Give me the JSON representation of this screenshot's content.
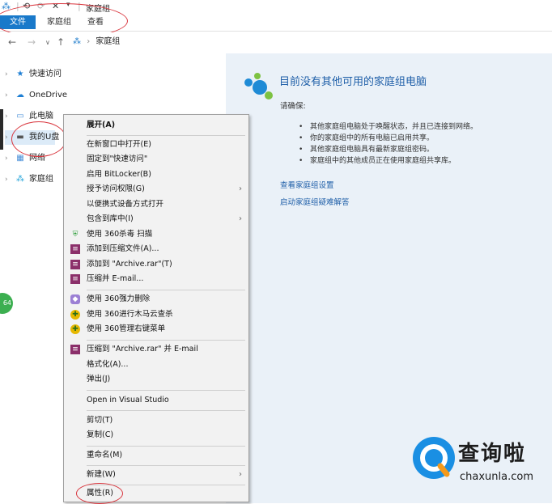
{
  "window": {
    "title": "家庭组",
    "quick_access": [
      "⟲",
      "⟳",
      "✕",
      "▾"
    ]
  },
  "ribbon": {
    "tabs": [
      "文件",
      "家庭组",
      "查看"
    ]
  },
  "address": {
    "path": "家庭组"
  },
  "sidebar": {
    "items": [
      {
        "label": "快速访问",
        "icon": "star-icon"
      },
      {
        "label": "OneDrive",
        "icon": "cloud-icon"
      },
      {
        "label": "此电脑",
        "icon": "computer-icon"
      },
      {
        "label": "我的U盘",
        "icon": "usb-drive-icon"
      },
      {
        "label": "网络",
        "icon": "network-icon"
      },
      {
        "label": "家庭组",
        "icon": "homegroup-icon"
      }
    ]
  },
  "homegroup": {
    "title": "目前没有其他可用的家庭组电脑",
    "subtitle": "请确保:",
    "bullets": [
      "其他家庭组电脑处于唤醒状态，并且已连接到网络。",
      "你的家庭组中的所有电脑已启用共享。",
      "其他家庭组电脑具有最新家庭组密码。",
      "家庭组中的其他成员正在使用家庭组共享库。"
    ],
    "links": [
      "查看家庭组设置",
      "启动家庭组疑难解答"
    ]
  },
  "context_menu": {
    "items": [
      {
        "label": "展开(A)",
        "bold": true
      },
      {
        "label": "在新窗口中打开(E)"
      },
      {
        "label": "固定到\"快速访问\""
      },
      {
        "label": "启用 BitLocker(B)"
      },
      {
        "label": "授予访问权限(G)",
        "submenu": true
      },
      {
        "label": "以便携式设备方式打开"
      },
      {
        "label": "包含到库中(I)",
        "submenu": true
      },
      {
        "label": "使用 360杀毒 扫描",
        "icon": "shield-icon"
      },
      {
        "label": "添加到压缩文件(A)...",
        "icon": "archive-icon"
      },
      {
        "label": "添加到 \"Archive.rar\"(T)",
        "icon": "archive-icon"
      },
      {
        "label": "压缩并 E-mail...",
        "icon": "archive-icon"
      },
      {
        "label": "使用 360强力删除",
        "icon": "delete-icon"
      },
      {
        "label": "使用 360进行木马云查杀",
        "icon": "trojan-scan-icon"
      },
      {
        "label": "使用 360管理右键菜单",
        "icon": "menu-manage-icon"
      },
      {
        "label": "压缩到 \"Archive.rar\" 并 E-mail",
        "icon": "archive-icon"
      },
      {
        "label": "格式化(A)..."
      },
      {
        "label": "弹出(J)"
      },
      {
        "label": "Open in Visual Studio"
      },
      {
        "label": "剪切(T)"
      },
      {
        "label": "复制(C)"
      },
      {
        "label": "重命名(M)"
      },
      {
        "label": "新建(W)",
        "submenu": true
      },
      {
        "label": "属性(R)"
      }
    ],
    "submenu_glyph": "›"
  },
  "badge": {
    "text": "64"
  },
  "brand": {
    "name": "查询啦",
    "url": "chaxunla.com"
  },
  "colors": {
    "accent": "#1979ca",
    "link": "#1f5fa8",
    "annotation": "#d9363e",
    "content_bg": "#eaf1f8",
    "menu_bg": "#f2f2f2"
  }
}
